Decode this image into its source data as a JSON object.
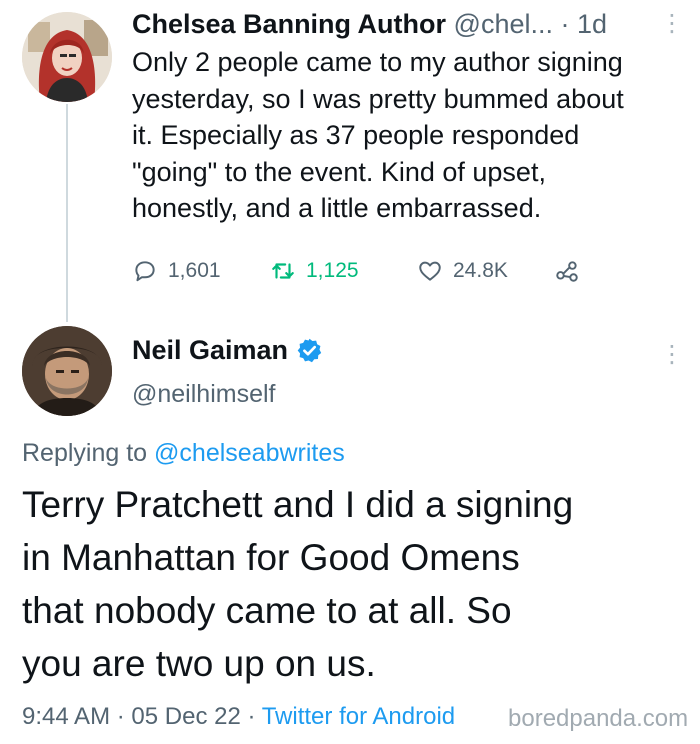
{
  "tweet_original": {
    "author_name": "Chelsea Banning Author",
    "handle": "@chel...",
    "separator": "·",
    "time": "1d",
    "avatar_icon": "profile-photo-red-haired-woman",
    "body_lines": [
      "Only 2 people came to my author signing",
      "yesterday, so I was pretty bummed about",
      "it. Especially as 37 people responded",
      "\"going\" to the event. Kind of upset,",
      "honestly, and a little embarrassed."
    ],
    "actions": {
      "replies": "1,601",
      "retweets": "1,125",
      "likes": "24.8K"
    },
    "colors": {
      "retweet_green": "#00ba7c",
      "secondary_text": "#536471"
    }
  },
  "tweet_reply": {
    "author_name": "Neil Gaiman",
    "handle": "@neilhimself",
    "avatar_icon": "profile-photo-bearded-man",
    "replying_prefix": "Replying to",
    "replying_to": "@chelseabwrites",
    "body_lines": [
      "Terry Pratchett and I did a signing",
      "in Manhattan for Good Omens",
      "that nobody came to at all.  So",
      "you are two up on us."
    ],
    "meta": {
      "time": "9:44 AM",
      "sep1": "·",
      "date": "05 Dec 22",
      "sep2": "·",
      "source": "Twitter for Android"
    },
    "colors": {
      "link_blue": "#1d9bf0",
      "verified_blue": "#1d9bf0"
    }
  },
  "watermark": "boredpanda.com"
}
